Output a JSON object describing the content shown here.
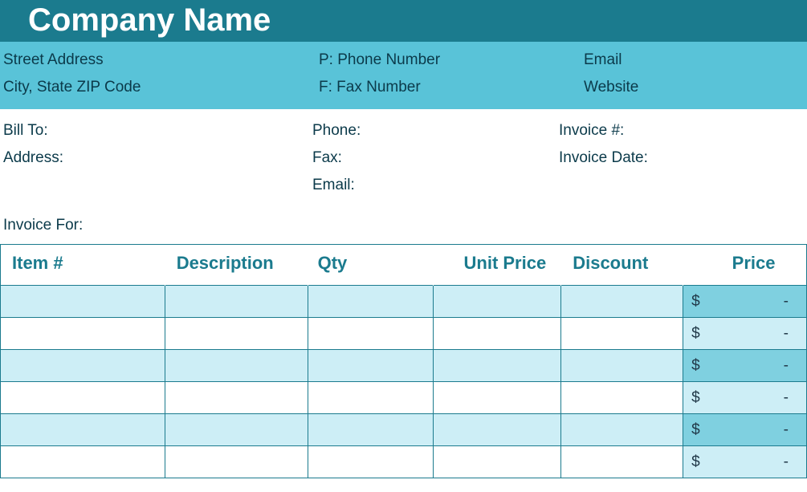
{
  "header": {
    "company_name": "Company Name"
  },
  "company_info": {
    "street": "Street Address",
    "city_state_zip": "City, State ZIP Code",
    "phone_label": "P: Phone Number",
    "fax_label": "F: Fax Number",
    "email_label": "Email",
    "website_label": "Website"
  },
  "bill": {
    "bill_to_label": "Bill To:",
    "address_label": "Address:",
    "phone_label": "Phone:",
    "fax_label": "Fax:",
    "email_label": "Email:",
    "invoice_no_label": "Invoice #:",
    "invoice_date_label": "Invoice Date:"
  },
  "invoice_for_label": "Invoice For:",
  "table": {
    "headers": {
      "item": "Item #",
      "description": "Description",
      "qty": "Qty",
      "unit_price": "Unit Price",
      "discount": "Discount",
      "price": "Price"
    },
    "rows": [
      {
        "item": "",
        "description": "",
        "qty": "",
        "unit_price": "",
        "discount": "",
        "price_currency": "$",
        "price_value": "-"
      },
      {
        "item": "",
        "description": "",
        "qty": "",
        "unit_price": "",
        "discount": "",
        "price_currency": "$",
        "price_value": "-"
      },
      {
        "item": "",
        "description": "",
        "qty": "",
        "unit_price": "",
        "discount": "",
        "price_currency": "$",
        "price_value": "-"
      },
      {
        "item": "",
        "description": "",
        "qty": "",
        "unit_price": "",
        "discount": "",
        "price_currency": "$",
        "price_value": "-"
      },
      {
        "item": "",
        "description": "",
        "qty": "",
        "unit_price": "",
        "discount": "",
        "price_currency": "$",
        "price_value": "-"
      },
      {
        "item": "",
        "description": "",
        "qty": "",
        "unit_price": "",
        "discount": "",
        "price_currency": "$",
        "price_value": "-"
      }
    ]
  }
}
